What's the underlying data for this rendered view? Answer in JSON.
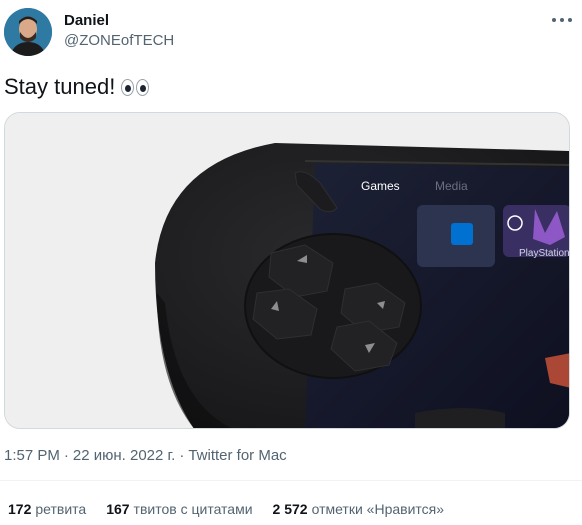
{
  "author": {
    "name": "Daniel",
    "handle": "@ZONEofTECH"
  },
  "tweet": {
    "text": "Stay tuned!",
    "emoji": "eyes-emoji"
  },
  "media": {
    "screen_tabs": [
      "Games",
      "Media"
    ],
    "tile_label": "PlayStation"
  },
  "meta": {
    "time": "1:57 PM",
    "sep1": "·",
    "date": "22 июн. 2022 г.",
    "sep2": "·",
    "source": "Twitter for Mac"
  },
  "stats": {
    "retweets_count": "172",
    "retweets_label": "ретвита",
    "quotes_count": "167",
    "quotes_label": "твитов с цитатами",
    "likes_count": "2 572",
    "likes_label": "отметки «Нравится»"
  },
  "icons": {
    "more": "more-icon",
    "avatar": "avatar"
  },
  "colors": {
    "text_primary": "#0f1419",
    "text_secondary": "#536471",
    "border": "#cfd9de",
    "device": "#1a1a1c"
  }
}
